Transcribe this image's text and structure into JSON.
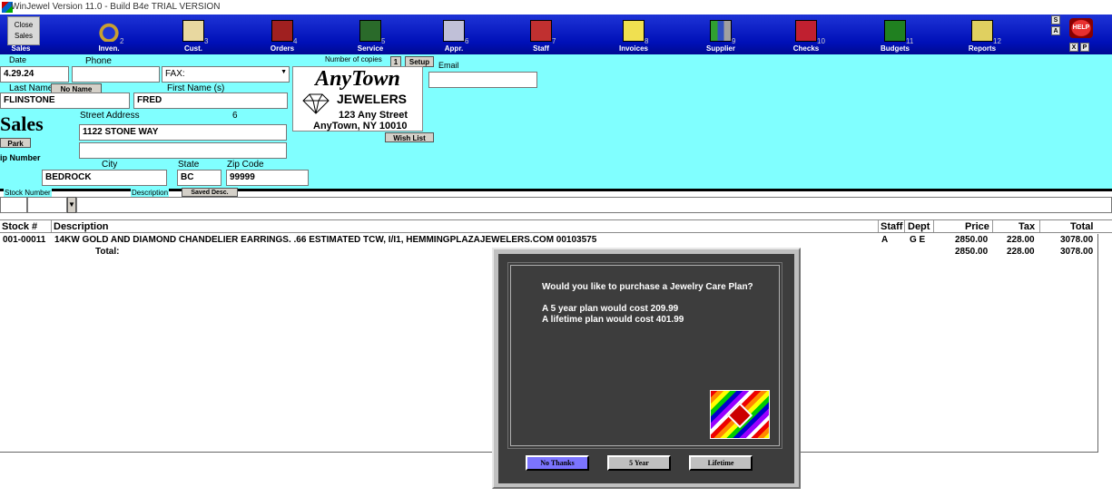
{
  "window": {
    "title": "WinJewel Version 11.0 - Build B4e   TRIAL VERSION"
  },
  "toolbar": {
    "close_sales": "Close Sales",
    "items": [
      {
        "label": "Sales",
        "num": ""
      },
      {
        "label": "Inven.",
        "num": "2"
      },
      {
        "label": "Cust.",
        "num": "3"
      },
      {
        "label": "Orders",
        "num": "4"
      },
      {
        "label": "Service",
        "num": "5"
      },
      {
        "label": "Appr.",
        "num": "6"
      },
      {
        "label": "Staff",
        "num": "7"
      },
      {
        "label": "Invoices",
        "num": "8"
      },
      {
        "label": "Supplier",
        "num": "9"
      },
      {
        "label": "Checks",
        "num": "10"
      },
      {
        "label": "Budgets",
        "num": "11"
      },
      {
        "label": "Reports",
        "num": "12"
      }
    ],
    "s_btn": "S",
    "a_btn": "A",
    "help": "HELP",
    "x_btn": "X",
    "p_btn": "P"
  },
  "form": {
    "date_label": "Date",
    "date_value": "4.29.24",
    "phone_label": "Phone",
    "phone_value": "",
    "fax_value": "FAX:",
    "copies_label": "Number of copies",
    "copies_value": "1",
    "setup_btn": "Setup",
    "email_label": "Email",
    "email_value": "",
    "last_name_label": "Last Name",
    "last_name_value": "FLINSTONE",
    "no_name_btn": "No Name",
    "first_name_label": "First Name (s)",
    "first_name_value": "FRED",
    "sales_title": "Sales",
    "street_label": "Street Address",
    "street_num": "6",
    "street_value": "1122 STONE WAY",
    "street2_value": "",
    "park_btn": "Park",
    "zip_number_label": "ip Number",
    "city_label": "City",
    "city_value": "BEDROCK",
    "state_label": "State",
    "state_value": "BC",
    "zip_label": "Zip Code",
    "zip_value": "99999",
    "wish_list_btn": "Wish List",
    "stock_number_label": "Stock Number",
    "description_label": "Description",
    "saved_desc_btn": "Saved Desc."
  },
  "store": {
    "name_line1": "AnyTown",
    "name_line2": "JEWELERS",
    "address": "123 Any Street",
    "city": "AnyTown, NY 10010"
  },
  "table": {
    "headers": {
      "stock": "Stock #",
      "description": "Description",
      "staff": "Staff",
      "dept": "Dept",
      "price": "Price",
      "tax": "Tax",
      "total": "Total"
    },
    "rows": [
      {
        "stock": "001-00011",
        "description": "14KW GOLD AND DIAMOND CHANDELIER EARRINGS. .66 ESTIMATED TCW, I/I1, HEMMINGPLAZAJEWELERS.COM 00103575",
        "staff": "A",
        "dept": "G E",
        "price": "2850.00",
        "tax": "228.00",
        "total": "3078.00"
      }
    ],
    "total_label": "Total:",
    "total_price": "2850.00",
    "total_tax": "228.00",
    "total_total": "3078.00"
  },
  "dialog": {
    "question": "Would you like to purchase a Jewelry Care Plan?",
    "line1": "A 5 year plan would cost 209.99",
    "line2": "A lifetime plan would cost 401.99",
    "btn_no": "No Thanks",
    "btn_5yr": "5 Year",
    "btn_life": "Lifetime",
    "btn_no_color": "#7b74ff"
  }
}
